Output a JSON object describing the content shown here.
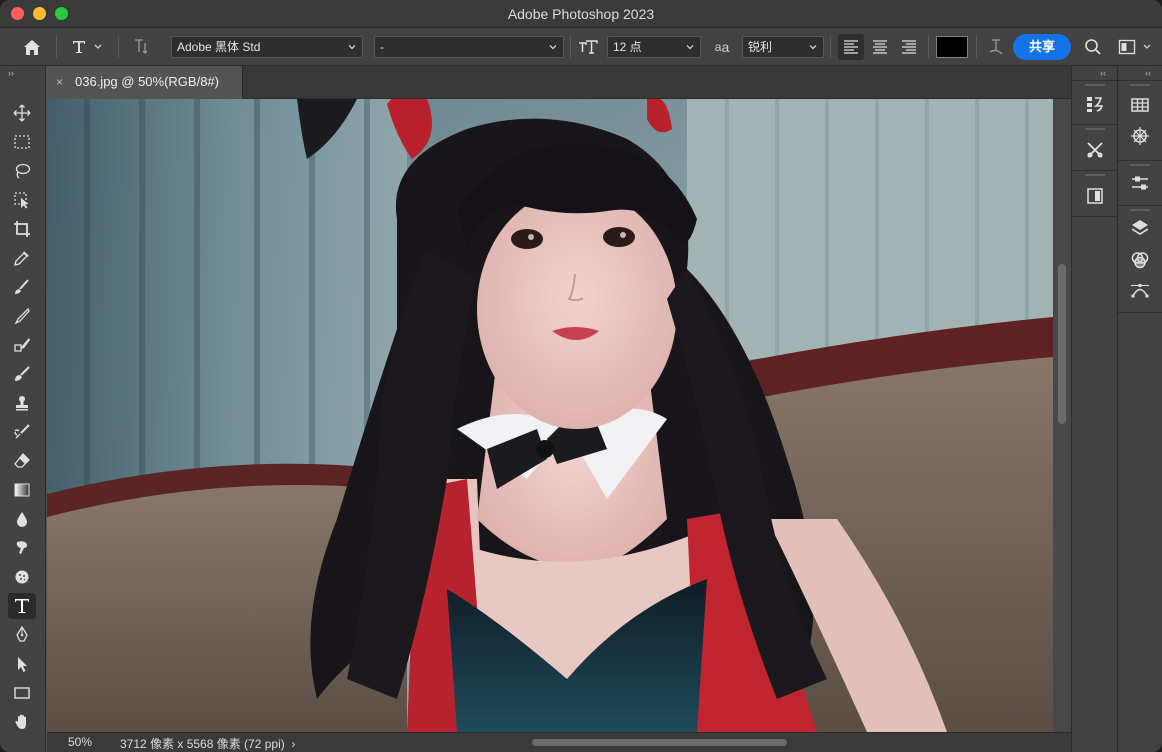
{
  "app": {
    "title": "Adobe Photoshop 2023"
  },
  "options_bar": {
    "font_family": "Adobe 黑体 Std",
    "font_style": "-",
    "font_size": "12 点",
    "aa_label": "a",
    "aa_sub": "a",
    "anti_alias": "锐利",
    "share_label": "共享",
    "text_color": "#000000"
  },
  "document": {
    "tab_label": "036.jpg @ 50%(RGB/8#)",
    "close_glyph": "×"
  },
  "status": {
    "zoom": "50%",
    "info": "3712 像素 x 5568 像素 (72 ppi)",
    "arrow": "›"
  },
  "toolbar": {
    "collapse": "››",
    "active_tool": "horizontal-type-tool"
  },
  "panels": {
    "collapse": "‹‹"
  }
}
